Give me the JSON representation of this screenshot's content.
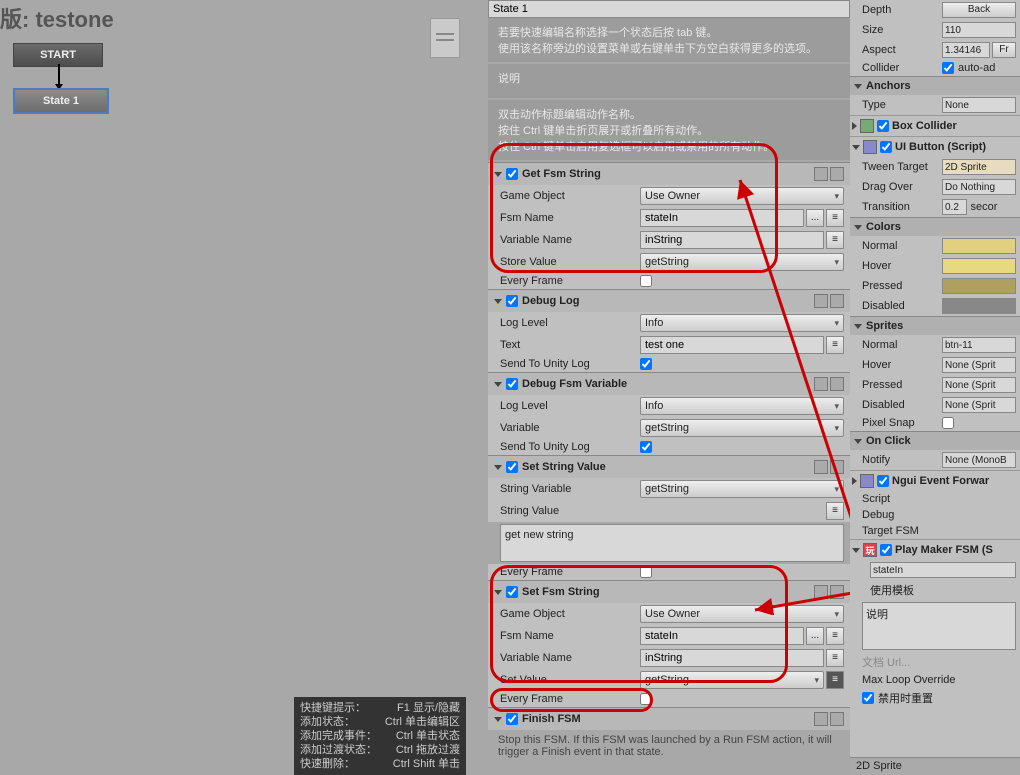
{
  "canvas": {
    "title": "版: testone",
    "start": "START",
    "state1": "State 1"
  },
  "top": {
    "state_field": "State 1",
    "info1a": "若要快速编辑名称选择一个状态后按 tab 键。",
    "info1b": "使用该名称旁边的设置菜单或右键单击下方空白获得更多的选项。",
    "info2": "说明",
    "info3a": "双击动作标题编辑动作名称。",
    "info3b": "按住 Ctrl 键单击折页展开或折叠所有动作。",
    "info3c": "按住 Ctrl 键单击启用复选框可以启用或禁用的所有动作。"
  },
  "actions": {
    "get_fsm_string": {
      "title": "Get Fsm String",
      "game_object": "Use Owner",
      "fsm_name": "stateIn",
      "variable_name": "inString",
      "store_value": "getString",
      "labels": {
        "go": "Game Object",
        "fn": "Fsm Name",
        "vn": "Variable Name",
        "sv": "Store Value",
        "ef": "Every Frame"
      }
    },
    "debug_log": {
      "title": "Debug Log",
      "log_level": "Info",
      "text": "test one",
      "labels": {
        "ll": "Log Level",
        "tx": "Text",
        "su": "Send To Unity Log"
      }
    },
    "debug_fsm_var": {
      "title": "Debug Fsm Variable",
      "log_level": "Info",
      "variable": "getString",
      "labels": {
        "ll": "Log Level",
        "v": "Variable",
        "su": "Send To Unity Log"
      }
    },
    "set_string_value": {
      "title": "Set String Value",
      "string_variable": "getString",
      "string_value": "get new string",
      "labels": {
        "sv": "String Variable",
        "svl": "String Value",
        "ef": "Every Frame"
      }
    },
    "set_fsm_string": {
      "title": "Set Fsm String",
      "game_object": "Use Owner",
      "fsm_name": "stateIn",
      "variable_name": "inString",
      "set_value": "getString",
      "labels": {
        "go": "Game Object",
        "fn": "Fsm Name",
        "vn": "Variable Name",
        "sv": "Set Value",
        "ef": "Every Frame"
      }
    },
    "finish_fsm": {
      "title": "Finish FSM",
      "desc": "Stop this FSM. If this FSM was launched by a Run FSM action, it will trigger a Finish event in that state."
    }
  },
  "tooltip": {
    "r1a": "快捷键提示：",
    "r1b": "F1 显示/隐藏",
    "r2a": "添加状态：",
    "r2b": "Ctrl 单击编辑区",
    "r3a": "添加完成事件：",
    "r3b": "Ctrl 单击状态",
    "r4a": "添加过渡状态：",
    "r4b": "Ctrl 拖放过渡",
    "r5a": "快速删除：",
    "r5b": "Ctrl Shift 单击"
  },
  "inspector": {
    "depth": {
      "lbl": "Depth",
      "btn": "Back"
    },
    "size": {
      "lbl": "Size",
      "val": "110"
    },
    "aspect": {
      "lbl": "Aspect",
      "val": "1.34146",
      "btn": "Fr"
    },
    "collider": {
      "lbl": "Collider",
      "val": "auto-ad"
    },
    "anchors": {
      "title": "Anchors",
      "type_lbl": "Type",
      "type_val": "None"
    },
    "box_collider": "Box Collider",
    "ui_button": {
      "title": "UI Button (Script)",
      "tween_target": {
        "lbl": "Tween Target",
        "val": "2D Sprite"
      },
      "drag_over": {
        "lbl": "Drag Over",
        "val": "Do Nothing"
      },
      "transition": {
        "lbl": "Transition",
        "val": "0.2",
        "unit": "secor"
      }
    },
    "colors": {
      "title": "Colors",
      "normal": "Normal",
      "hover": "Hover",
      "pressed": "Pressed",
      "disabled": "Disabled"
    },
    "sprites": {
      "title": "Sprites",
      "normal": "Normal",
      "normal_v": "btn-11",
      "hover": "Hover",
      "hover_v": "None (Sprit",
      "pressed": "Pressed",
      "pressed_v": "None (Sprit",
      "disabled": "Disabled",
      "disabled_v": "None (Sprit",
      "pixel": "Pixel Snap"
    },
    "onclick": {
      "title": "On Click",
      "notify": "Notify",
      "notify_v": "None (MonoB"
    },
    "ngui": {
      "title": "Ngui Event Forwar",
      "script": "Script",
      "debug": "Debug",
      "target": "Target FSM"
    },
    "pm": {
      "title": "Play Maker FSM (S",
      "statein": "stateIn",
      "template": "使用模板",
      "desc": "说明",
      "doc": "文档 Url...",
      "maxloop": "Max Loop Override",
      "reset": "禁用时重置"
    },
    "status": "2D Sprite"
  }
}
